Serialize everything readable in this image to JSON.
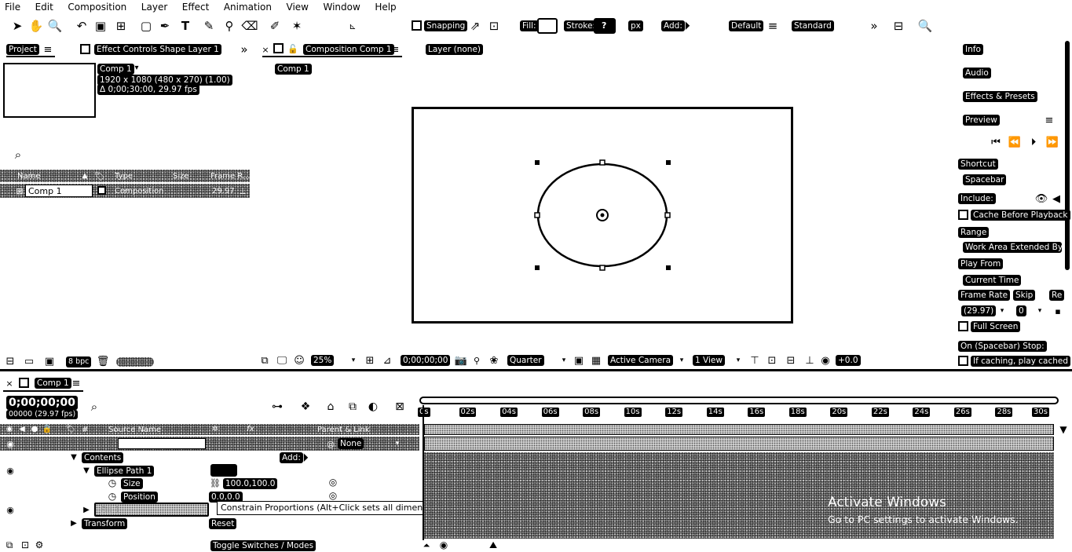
{
  "menubar": [
    "File",
    "Edit",
    "Composition",
    "Layer",
    "Effect",
    "Animation",
    "View",
    "Window",
    "Help"
  ],
  "toolbar": {
    "snapping": "Snapping",
    "fill": "Fill:",
    "stroke": "Stroke:",
    "stroke_value": "?",
    "px": "px",
    "add": "Add:",
    "workspace_default": "Default",
    "workspace_standard": "Standard"
  },
  "project_panel": {
    "tab": "Project",
    "effect_controls_tab": "Effect Controls Shape Layer 1",
    "comp_name": "Comp 1",
    "comp_res": "1920 x 1080 (480 x 270) (1.00)",
    "comp_duration": "Δ 0;00;30;00, 29.97 fps",
    "columns": {
      "name": "Name",
      "type": "Type",
      "size": "Size",
      "frame_rate": "Frame R..."
    },
    "rows": [
      {
        "name": "Comp 1",
        "type": "Composition",
        "frame_rate": "29.97"
      }
    ],
    "bpc": "8 bpc"
  },
  "comp_panel": {
    "tab": "Composition Comp 1",
    "layer_tab": "Layer (none)",
    "breadcrumb": "Comp 1",
    "zoom": "25%",
    "timecode": "0;00;00;00",
    "resolution": "Quarter",
    "camera": "Active Camera",
    "views": "1 View",
    "exposure": "+0.0"
  },
  "right_panel": {
    "sections": [
      "Info",
      "Audio",
      "Effects & Presets",
      "Preview"
    ],
    "shortcut_label": "Shortcut",
    "shortcut_value": "Spacebar",
    "include_label": "Include:",
    "cache_label": "Cache Before Playback",
    "range_label": "Range",
    "range_value": "Work Area Extended By C",
    "play_from_label": "Play From",
    "play_from_value": "Current Time",
    "frame_rate_label": "Frame Rate",
    "skip_label": "Skip",
    "res_label": "Re",
    "frame_rate_value": "(29.97)",
    "skip_value": "0",
    "full_screen": "Full Screen",
    "stop_label": "On (Spacebar) Stop:",
    "stop_option": "If caching, play cached"
  },
  "timeline": {
    "tab": "Comp 1",
    "timecode": "0;00;00;00",
    "frames": "00000 (29.97 fps)",
    "source_name_header": "Source Name",
    "parent_header": "Parent & Link",
    "parent_value": "None",
    "contents": "Contents",
    "add": "Add:",
    "ellipse_path": "Ellipse Path 1",
    "size_label": "Size",
    "size_value": "100.0,100.0",
    "position_label": "Position",
    "position_value": "0.0,0.0",
    "fill_label": "Fill 1",
    "transform": "Transform",
    "reset": "Reset",
    "toggle": "Toggle Switches / Modes",
    "ticks": [
      "0s",
      "02s",
      "04s",
      "06s",
      "08s",
      "10s",
      "12s",
      "14s",
      "16s",
      "18s",
      "20s",
      "22s",
      "24s",
      "26s",
      "28s",
      "30s"
    ]
  },
  "tooltip": "Constrain Proportions (Alt+Click sets all dimensions to the same value.)",
  "watermark": {
    "title": "Activate Windows",
    "subtitle": "Go to PC settings to activate Windows."
  }
}
